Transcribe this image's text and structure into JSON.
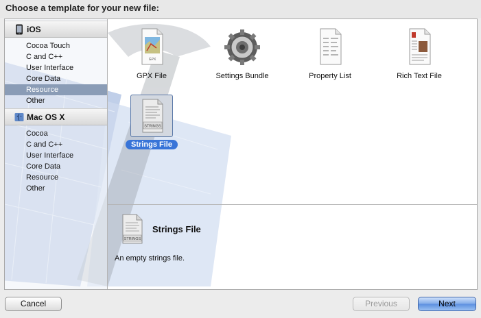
{
  "header": {
    "title": "Choose a template for your new file:"
  },
  "sidebar": {
    "groups": [
      {
        "label": "iOS",
        "icon": "iphone-icon",
        "items": [
          "Cocoa Touch",
          "C and C++",
          "User Interface",
          "Core Data",
          "Resource",
          "Other"
        ],
        "selected": "Resource"
      },
      {
        "label": "Mac OS X",
        "icon": "mac-os-x-icon",
        "items": [
          "Cocoa",
          "C and C++",
          "User Interface",
          "Core Data",
          "Resource",
          "Other"
        ]
      }
    ]
  },
  "templates": [
    {
      "label": "GPX File",
      "icon": "gpx-file-icon",
      "icon_text": "GPX"
    },
    {
      "label": "Settings Bundle",
      "icon": "settings-bundle-icon"
    },
    {
      "label": "Property List",
      "icon": "property-list-icon"
    },
    {
      "label": "Rich Text File",
      "icon": "rich-text-file-icon"
    },
    {
      "label": "Strings File",
      "icon": "strings-file-icon",
      "icon_text": "STRINGS",
      "selected": true
    }
  ],
  "detail": {
    "title": "Strings File",
    "description": "An empty strings file.",
    "icon_text": "STRINGS"
  },
  "buttons": {
    "cancel": "Cancel",
    "previous": "Previous",
    "next": "Next"
  },
  "colors": {
    "selection": "#3874d8",
    "sidebar_selection": "#8a9cb6",
    "background": "#ececec"
  }
}
